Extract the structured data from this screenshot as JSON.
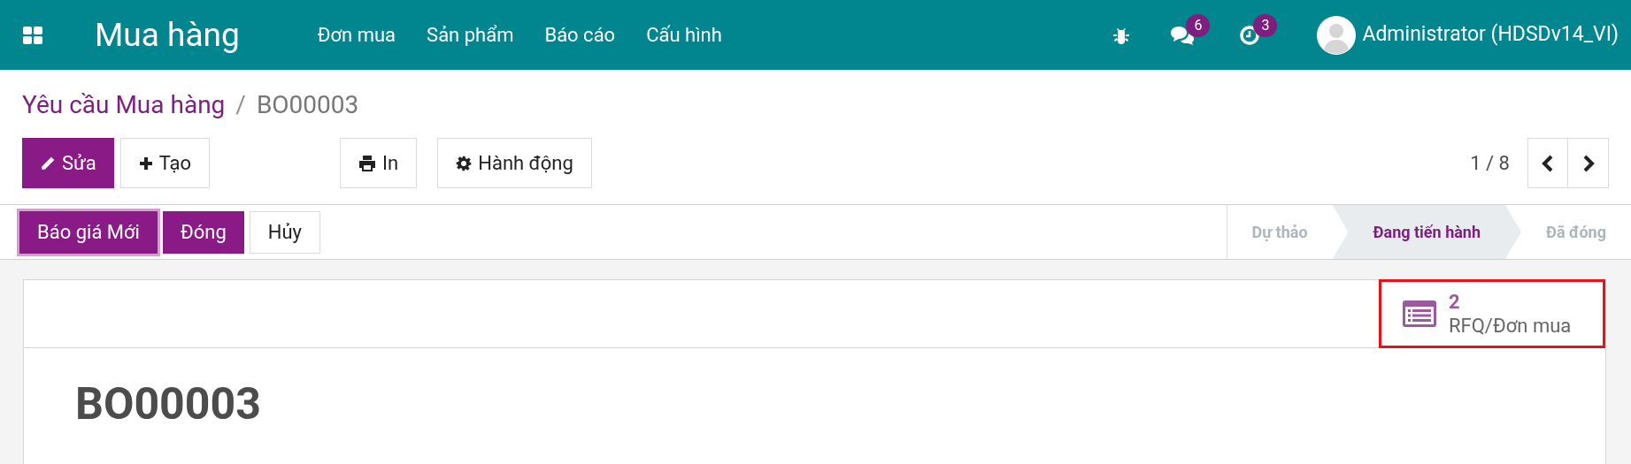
{
  "navbar": {
    "app_title": "Mua hàng",
    "menu": [
      {
        "label": "Đơn mua"
      },
      {
        "label": "Sản phẩm"
      },
      {
        "label": "Báo cáo"
      },
      {
        "label": "Cấu hình"
      }
    ],
    "messages_badge": "6",
    "activities_badge": "3",
    "user": "Administrator (HDSDv14_VI)"
  },
  "breadcrumb": {
    "parent": "Yêu cầu Mua hàng",
    "separator": "/",
    "current": "BO00003"
  },
  "control_buttons": [
    {
      "label": "Sửa",
      "kind": "edit"
    },
    {
      "label": "Tạo",
      "kind": "create"
    },
    {
      "label": "In",
      "kind": "print"
    },
    {
      "label": "Hành động",
      "kind": "action"
    }
  ],
  "pager": "1 / 8",
  "status_buttons": [
    {
      "label": "Báo giá Mới",
      "kind": "primary",
      "focused": true
    },
    {
      "label": "Đóng",
      "kind": "primary",
      "focused": false
    },
    {
      "label": "Hủy",
      "kind": "secondary",
      "focused": false
    }
  ],
  "stages": [
    {
      "label": "Dự thảo",
      "selected": false
    },
    {
      "label": "Đang tiến hành",
      "selected": true
    },
    {
      "label": "Đã đóng",
      "selected": false
    }
  ],
  "smart_button": {
    "count": "2",
    "label": "RFQ/Đơn mua",
    "highlighted": true
  },
  "record_title": "BO00003"
}
